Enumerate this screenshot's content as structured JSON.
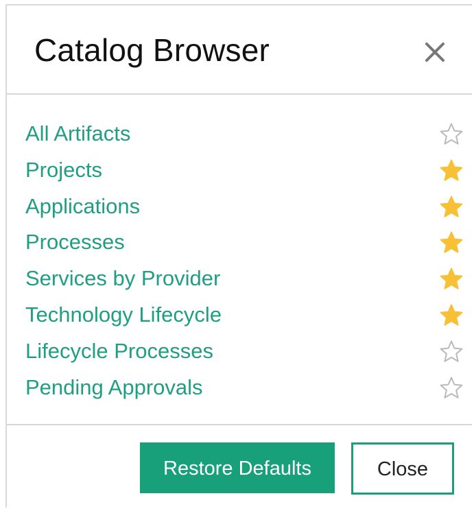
{
  "dialog": {
    "title": "Catalog Browser",
    "close_icon": "close-icon"
  },
  "catalog": {
    "items": [
      {
        "label": "All Artifacts",
        "favorite": false
      },
      {
        "label": "Projects",
        "favorite": true
      },
      {
        "label": "Applications",
        "favorite": true
      },
      {
        "label": "Processes",
        "favorite": true
      },
      {
        "label": "Services by Provider",
        "favorite": true
      },
      {
        "label": "Technology Lifecycle",
        "favorite": true
      },
      {
        "label": "Lifecycle Processes",
        "favorite": false
      },
      {
        "label": "Pending Approvals",
        "favorite": false
      }
    ]
  },
  "footer": {
    "restore_label": "Restore Defaults",
    "close_label": "Close"
  },
  "colors": {
    "link": "#1f9e82",
    "accent": "#18a07b",
    "star_filled": "#f7c035",
    "star_empty": "#b9b9b9"
  }
}
